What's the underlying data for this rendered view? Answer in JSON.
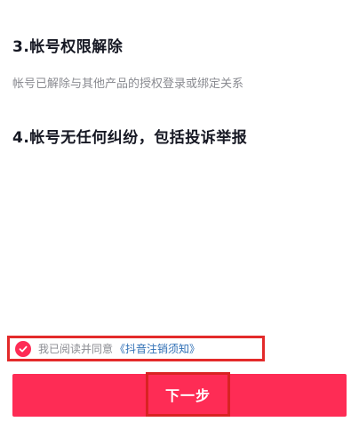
{
  "sections": [
    {
      "title": "3.帐号权限解除",
      "description": "帐号已解除与其他产品的授权登录或绑定关系"
    },
    {
      "title": "4.帐号无任何纠纷，包括投诉举报"
    }
  ],
  "agreement": {
    "checked": true,
    "text": "我已阅读并同意",
    "link": "《抖音注销须知》"
  },
  "next_button": {
    "label": "下一步"
  },
  "colors": {
    "accent": "#fe2c55",
    "highlight_border": "#e32a2a",
    "link": "#2f6fb5",
    "muted_text": "#8a8b91"
  },
  "icons": {
    "agree_check": "checkmark-circle-icon"
  }
}
